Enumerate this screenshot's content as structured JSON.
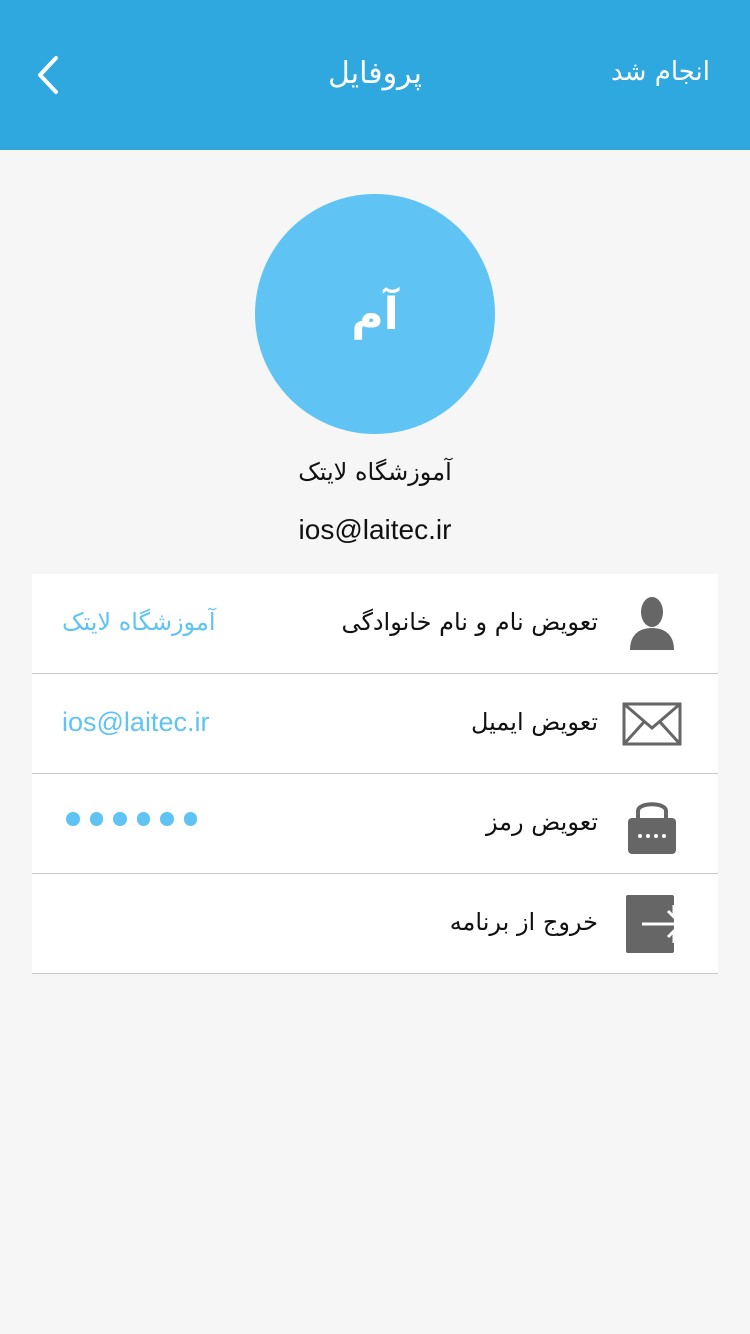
{
  "navbar": {
    "title": "پروفایل",
    "done_label": "انجام شد",
    "back_icon": "chevron-left-icon"
  },
  "profile": {
    "avatar_initials": "آم",
    "name": "آموزشگاه لایتک",
    "email": "ios@laitec.ir"
  },
  "settings": {
    "items": [
      {
        "icon": "person-icon",
        "label": "تعویض نام و نام خانوادگی",
        "value": "آموزشگاه لایتک"
      },
      {
        "icon": "envelope-icon",
        "label": "تعویض ایمیل",
        "value": "ios@laitec.ir"
      },
      {
        "icon": "lock-icon",
        "label": "تعویض رمز",
        "value_masked_length": 6
      },
      {
        "icon": "logout-icon",
        "label": "خروج از برنامه"
      }
    ]
  },
  "colors": {
    "navbar": "#2ea8df",
    "accent": "#5fc3f3",
    "background": "#f6f6f6",
    "icon_gray": "#666666"
  }
}
